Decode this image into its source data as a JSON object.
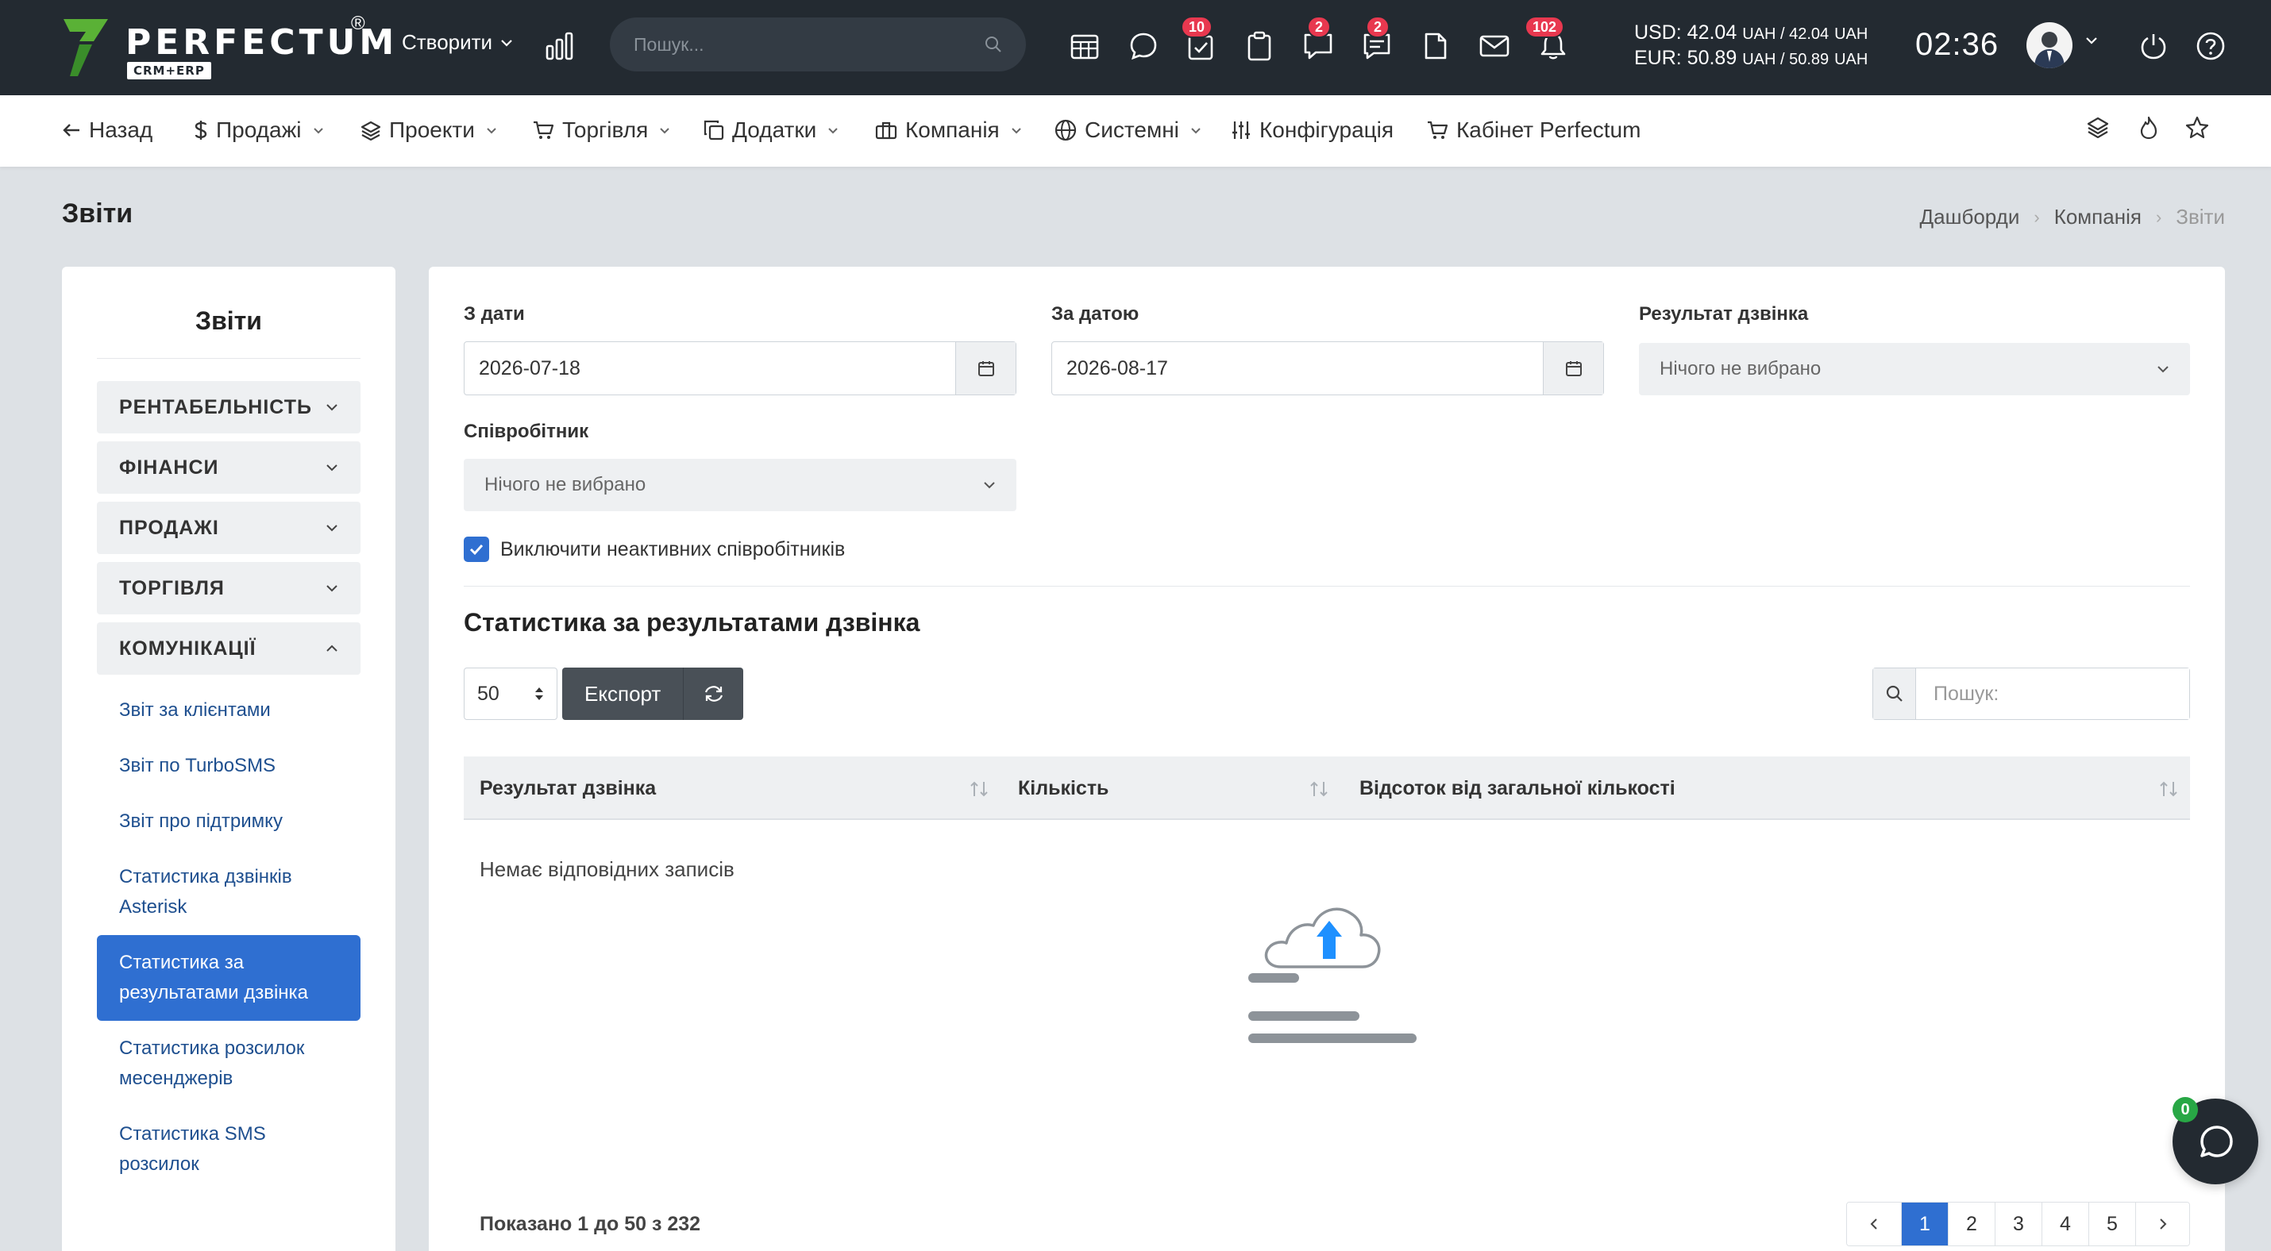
{
  "brand": {
    "name": "PERFECTUM",
    "registered": "®",
    "subtitle": "CRM+ERP"
  },
  "topbar": {
    "create_label": "Створити",
    "search_placeholder": "Пошук...",
    "badges": {
      "tasks": "10",
      "chat": "2",
      "messages": "2",
      "notifications": "102"
    },
    "currency_usd": "USD: 42.04",
    "currency_usd_rest": "UAH / 42.04",
    "currency_eur": "EUR: 50.89",
    "currency_eur_rest": "UAH / 50.89",
    "currency_unit": "UAH",
    "time": "02:36"
  },
  "nav": {
    "back": "Назад",
    "sales": "Продажі",
    "projects": "Проекти",
    "trade": "Торгівля",
    "addons": "Додатки",
    "company": "Компанія",
    "system": "Системні",
    "config": "Конфігурація",
    "cabinet": "Кабінет Perfectum"
  },
  "page": {
    "title": "Звіти",
    "breadcrumb": [
      "Дашборди",
      "Компанія",
      "Звіти"
    ]
  },
  "sidebar": {
    "title": "Звіти",
    "groups": [
      "РЕНТАБЕЛЬНІСТЬ",
      "ФІНАНСИ",
      "ПРОДАЖІ",
      "ТОРГІВЛЯ",
      "КОМУНІКАЦІЇ"
    ],
    "links": [
      "Звіт за клієнтами",
      "Звіт по TurboSMS",
      "Звіт про підтримку",
      "Статистика дзвінків Asterisk",
      "Статистика за результатами дзвінка",
      "Статистика розсилок месенджерів",
      "Статистика SMS розсилок"
    ]
  },
  "filters": {
    "from_label": "З дати",
    "from_value": "2026-07-18",
    "to_label": "За датою",
    "to_value": "2026-08-17",
    "result_label": "Результат дзвінка",
    "result_value": "Нічого не вибрано",
    "employee_label": "Співробітник",
    "employee_value": "Нічого не вибрано",
    "exclude_inactive": "Виключити неактивних співробітників"
  },
  "report": {
    "title": "Статистика за результатами дзвінка",
    "page_size": "50",
    "export_label": "Експорт",
    "search_placeholder": "Пошук:",
    "columns": [
      "Результат дзвінка",
      "Кількість",
      "Відсоток від загальної кількості"
    ],
    "empty": "Немає відповідних записів",
    "info": "Показано 1 до 50 з 232",
    "pages": [
      "1",
      "2",
      "3",
      "4",
      "5"
    ]
  },
  "chat": {
    "badge": "0"
  },
  "colors": {
    "primary": "#2f6fd1",
    "topbar": "#232a31",
    "badge": "#e8384f"
  }
}
